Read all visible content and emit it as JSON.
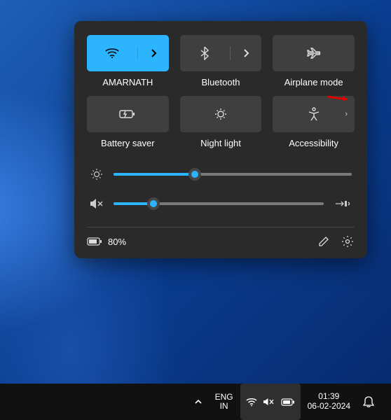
{
  "tiles": {
    "wifi": {
      "label": "AMARNATH",
      "active": true
    },
    "bluetooth": {
      "label": "Bluetooth",
      "active": false
    },
    "airplane": {
      "label": "Airplane mode",
      "active": false
    },
    "battery_saver": {
      "label": "Battery saver",
      "active": false
    },
    "night_light": {
      "label": "Night light",
      "active": false
    },
    "accessibility": {
      "label": "Accessibility",
      "active": false
    }
  },
  "sliders": {
    "brightness": {
      "percent": 34
    },
    "volume": {
      "percent": 19,
      "muted": true
    }
  },
  "footer": {
    "battery_text": "80%"
  },
  "taskbar": {
    "lang_primary": "ENG",
    "lang_secondary": "IN",
    "time": "01:39",
    "date": "06-02-2024"
  }
}
